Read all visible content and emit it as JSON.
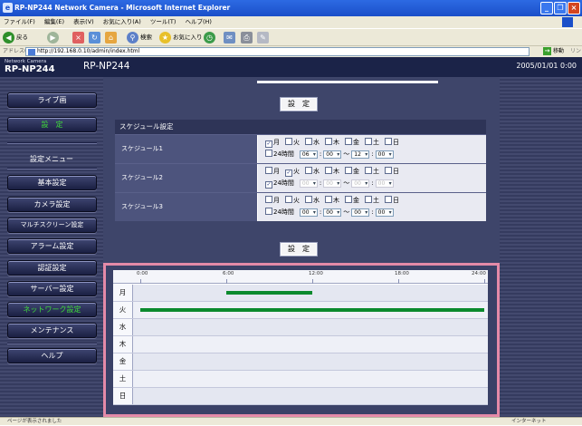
{
  "window": {
    "title": "RP-NP244 Network Camera - Microsoft Internet Explorer",
    "minimize": "_",
    "restore": "❐",
    "close": "×"
  },
  "menu": [
    "ファイル(F)",
    "編集(E)",
    "表示(V)",
    "お気に入り(A)",
    "ツール(T)",
    "ヘルプ(H)"
  ],
  "toolbar": {
    "back": "戻る",
    "search": "検索",
    "favorites": "お気に入り"
  },
  "address": {
    "label": "アドレス(D)",
    "url": "http://192.168.0.10/admin/index.html",
    "go": "移動",
    "links": "リン"
  },
  "header": {
    "brand_sub": "Network Camera",
    "model": "RP-NP244",
    "title": "RP-NP244",
    "datetime": "2005/01/01  0:00"
  },
  "sidebar": {
    "live": "ライブ画",
    "settings": "設　定",
    "menu_title": "設定メニュー",
    "items": [
      {
        "label": "基本設定",
        "active": false
      },
      {
        "label": "カメラ設定",
        "active": false
      },
      {
        "label": "マルチスクリーン設定",
        "active": false
      },
      {
        "label": "アラーム設定",
        "active": false
      },
      {
        "label": "認証設定",
        "active": false
      },
      {
        "label": "サーバー設定",
        "active": false
      },
      {
        "label": "ネットワーク設定",
        "active": true
      },
      {
        "label": "メンテナンス",
        "active": false
      }
    ],
    "help": "ヘルプ"
  },
  "colors": {
    "active_menu": "#3fdc3a",
    "timeline_bar": "#0b8a2e",
    "highlight_border": "#e48aa8"
  },
  "buttons": {
    "set": "設　定"
  },
  "schedule": {
    "heading": "スケジュール設定",
    "day_labels": [
      "月",
      "火",
      "水",
      "木",
      "金",
      "土",
      "日"
    ],
    "all_day_label": "24時間",
    "separator": "～",
    "rows": [
      {
        "label": "スケジュール1",
        "days": [
          true,
          false,
          false,
          false,
          false,
          false,
          false
        ],
        "all_day": false,
        "start_h": "06",
        "start_m": "00",
        "end_h": "12",
        "end_m": "00",
        "disabled": false
      },
      {
        "label": "スケジュール2",
        "days": [
          false,
          true,
          false,
          false,
          false,
          false,
          false
        ],
        "all_day": true,
        "start_h": "00",
        "start_m": "00",
        "end_h": "00",
        "end_m": "00",
        "disabled": true
      },
      {
        "label": "スケジュール3",
        "days": [
          false,
          false,
          false,
          false,
          false,
          false,
          false
        ],
        "all_day": false,
        "start_h": "00",
        "start_m": "00",
        "end_h": "00",
        "end_m": "00",
        "disabled": false
      }
    ]
  },
  "timeline": {
    "ticks": [
      "0:00",
      "6:00",
      "12:00",
      "18:00",
      "24:00"
    ],
    "days": [
      "月",
      "火",
      "水",
      "木",
      "金",
      "土",
      "日"
    ],
    "bars": [
      {
        "day": 0,
        "start": 6,
        "end": 12
      },
      {
        "day": 1,
        "start": 0,
        "end": 24
      }
    ]
  },
  "status": {
    "left": "ページが表示されました",
    "right": "インターネット"
  }
}
